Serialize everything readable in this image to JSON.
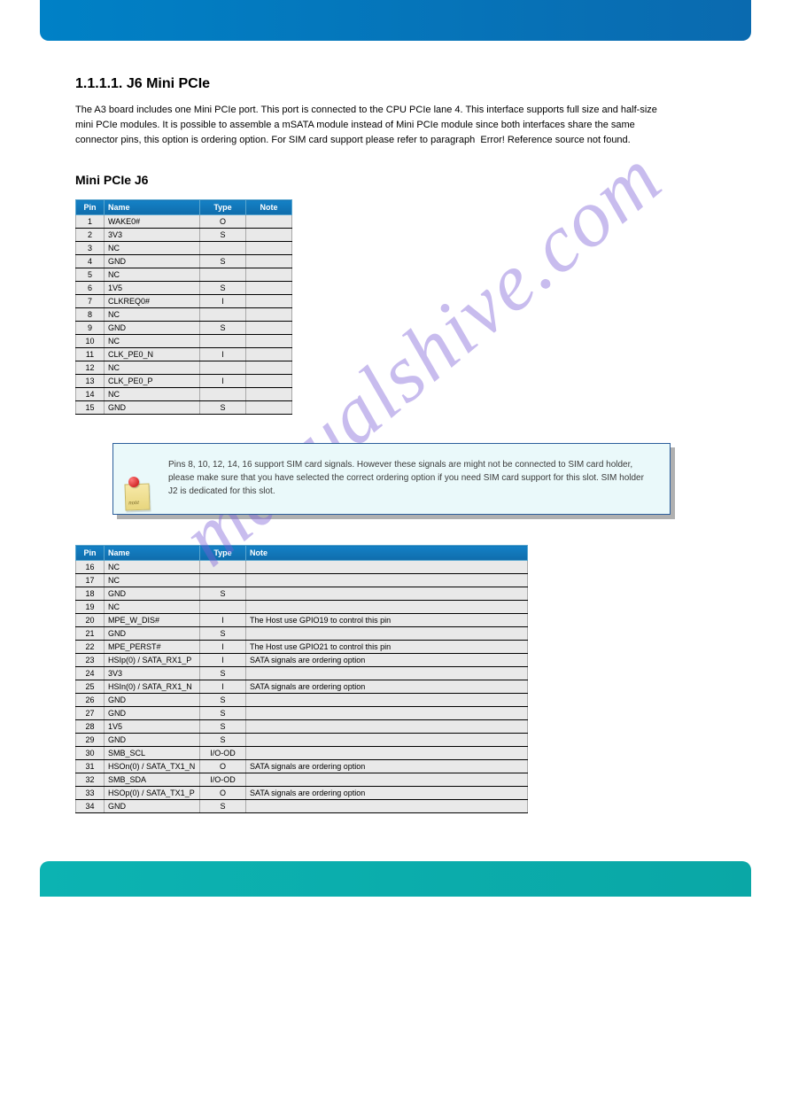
{
  "watermark": "manualshive.com",
  "intro": {
    "heading": "1.1.1.1. J6 Mini PCIe",
    "body": "The A3 board includes one Mini PCIe port. This port is connected to the CPU PCIe lane 4. This interface supports full size and half-size mini PCIe modules. It is possible to assemble a mSATA module instead of Mini PCIe module since both interfaces share the same connector pins, this option is ordering option. For SIM card support please refer to paragraph ‎ Error! Reference source not found."
  },
  "section_heading": "Mini PCIe J6",
  "t1": {
    "headers": [
      "Pin",
      "Name",
      "Type",
      "Note"
    ],
    "rows": [
      [
        "1",
        "WAKE0#",
        "O",
        ""
      ],
      [
        "2",
        "3V3",
        "S",
        ""
      ],
      [
        "3",
        "NC",
        "",
        ""
      ],
      [
        "4",
        "GND",
        "S",
        ""
      ],
      [
        "5",
        "NC",
        "",
        ""
      ],
      [
        "6",
        "1V5",
        "S",
        ""
      ],
      [
        "7",
        "CLKREQ0#",
        "I",
        ""
      ],
      [
        "8",
        "NC",
        "",
        ""
      ],
      [
        "9",
        "GND",
        "S",
        ""
      ],
      [
        "10",
        "NC",
        "",
        ""
      ],
      [
        "11",
        "CLK_PE0_N",
        "I",
        ""
      ],
      [
        "12",
        "NC",
        "",
        ""
      ],
      [
        "13",
        "CLK_PE0_P",
        "I",
        ""
      ],
      [
        "14",
        "NC",
        "",
        ""
      ],
      [
        "15",
        "GND",
        "S",
        ""
      ]
    ]
  },
  "note": "Pins 8, 10, 12, 14, 16 support SIM card signals. However these signals are might not be connected to SIM card holder, please make sure that you have selected the correct ordering option if you need SIM card support for this slot. SIM holder J2 is dedicated for this slot.",
  "t2": {
    "headers": [
      "Pin",
      "Name",
      "Type",
      "Note"
    ],
    "rows": [
      [
        "16",
        "NC",
        "",
        ""
      ],
      [
        "17",
        "NC",
        "",
        ""
      ],
      [
        "18",
        "GND",
        "S",
        ""
      ],
      [
        "19",
        "NC",
        "",
        ""
      ],
      [
        "20",
        "MPE_W_DIS#",
        "I",
        "The Host use GPIO19 to control this pin"
      ],
      [
        "21",
        "GND",
        "S",
        ""
      ],
      [
        "22",
        "MPE_PERST#",
        "I",
        "The Host use GPIO21 to control this pin"
      ],
      [
        "23",
        "HSIp(0) / SATA_RX1_P",
        "I",
        "SATA signals are ordering option"
      ],
      [
        "24",
        "3V3",
        "S",
        ""
      ],
      [
        "25",
        "HSIn(0) / SATA_RX1_N",
        "I",
        "SATA signals are ordering option"
      ],
      [
        "26",
        "GND",
        "S",
        ""
      ],
      [
        "27",
        "GND",
        "S",
        ""
      ],
      [
        "28",
        "1V5",
        "S",
        ""
      ],
      [
        "29",
        "GND",
        "S",
        ""
      ],
      [
        "30",
        "SMB_SCL",
        "I/O-OD",
        ""
      ],
      [
        "31",
        "HSOn(0) / SATA_TX1_N",
        "O",
        "SATA signals are ordering option"
      ],
      [
        "32",
        "SMB_SDA",
        "I/O-OD",
        ""
      ],
      [
        "33",
        "HSOp(0) / SATA_TX1_P",
        "O",
        "SATA signals are ordering option"
      ],
      [
        "34",
        "GND",
        "S",
        ""
      ]
    ]
  }
}
